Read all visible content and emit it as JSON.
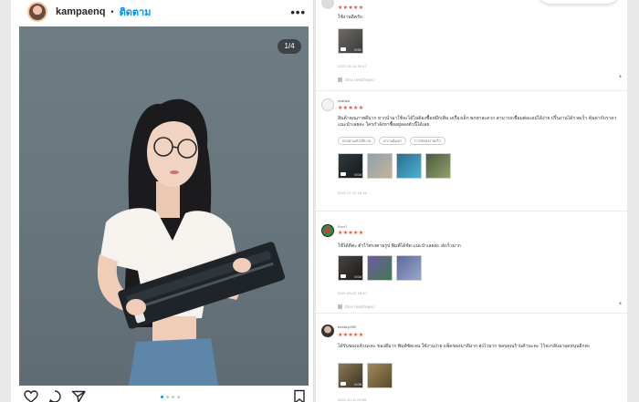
{
  "post": {
    "username": "kampaenq",
    "separator": "•",
    "follow_label": "ติดตาม",
    "more_label": "•••",
    "slide_counter": "1/4"
  },
  "reviews": [
    {
      "id": "r1",
      "username": "",
      "stars": "★★★★★",
      "text": "ใช้งานดีครับ",
      "media": [
        {
          "duration": "0:51",
          "video": true
        }
      ],
      "date": "2021-05-18 20:47",
      "helpful": "มีประโยชน์กับคุณ?"
    },
    {
      "id": "r2",
      "username": "maluka",
      "stars": "★★★★★",
      "text": "สินค้าคุณภาพดีมาก หากนำมาใช้จะได้ไม่ต้องซื้อหมึกเพิ่ม เครื่องเล็ก พกพาสะดวก สามารถเชื่อมต่อแอปได้ง่าย ปริ้นงานได้รวดเร็ว คุ้มค่ากับราคา แนะนำเลยค่ะ ใครกำลังหาซื้ออยู่ลองตัวนี้ได้เลย",
      "tags": [
        "ตรงตามคำอธิบาย",
        "ความคุ้มค่า",
        "การจัดส่งรวดเร็ว"
      ],
      "media": [
        {
          "duration": "0:04",
          "video": true
        },
        {
          "duration": "",
          "video": false
        },
        {
          "duration": "",
          "video": false
        },
        {
          "duration": "",
          "video": false
        }
      ],
      "date": "2021-07-12 16:18",
      "helpful": "มีประโยชน์กับคุณ?"
    },
    {
      "id": "r3",
      "username": "ก••••า",
      "stars": "★★★★★",
      "text": "ใช้ได้ดีค่ะ ตัวไว้ตรงตามรูป พิมพ์ได้ชัด แนะนำเลยค่ะ ส่งเร็วมาก",
      "media": [
        {
          "duration": "0:04",
          "video": true
        },
        {
          "duration": "",
          "video": false
        },
        {
          "duration": "",
          "video": false
        }
      ],
      "date": "2021-09-02 15:10",
      "helpful": "มีประโยชน์กับคุณ?"
    },
    {
      "id": "r4",
      "username": "fonda.p999",
      "stars": "★★★★★",
      "text": "ได้รับของแล้วนะคะ ของดีมาก พิมพ์ชัดเจน ใช้งานง่าย แพ็คของมาดีมาก ส่งไวมาก ขอบคุณร้านค้านะคะ ไว้จะกลับมาอุดหนุนอีกค่ะ",
      "media": [
        {
          "duration": "0:05",
          "video": true
        },
        {
          "duration": "",
          "video": false
        }
      ],
      "date": "2021-10-11 09:56",
      "helpful": "มีประโยชน์กับคุณ?"
    }
  ],
  "colors": {
    "accent_blue": "#0095f6",
    "star_red": "#ee4d2d"
  }
}
